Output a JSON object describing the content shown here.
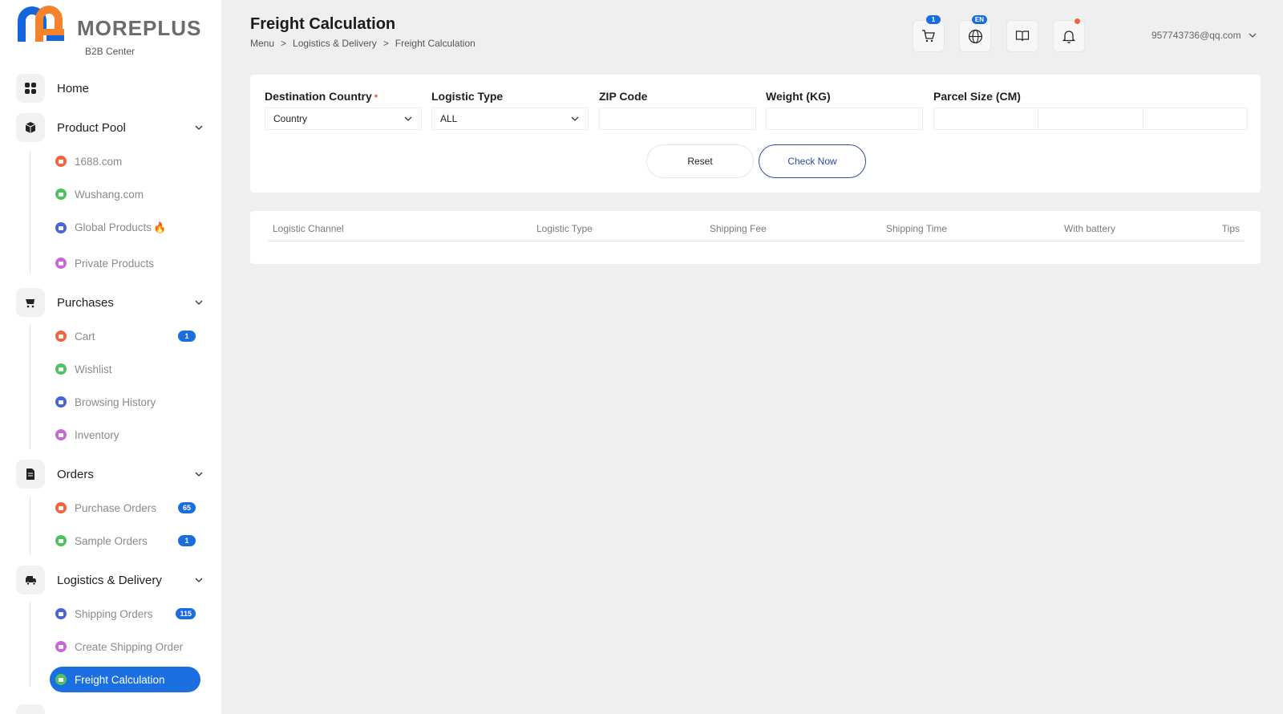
{
  "brand": {
    "name": "MOREPLUS",
    "subtitle": "B2B Center"
  },
  "sidebar": {
    "groups": [
      {
        "label": "Home",
        "icon": "grid-icon"
      },
      {
        "label": "Product Pool",
        "icon": "box-icon",
        "items": [
          {
            "label": "1688.com",
            "color": "#f0653a"
          },
          {
            "label": "Wushang.com",
            "color": "#4cc35e"
          },
          {
            "label": "Global Products",
            "color": "#4a63d6",
            "hot": "🔥"
          },
          {
            "label": "Private Products",
            "color": "#c86ad6"
          }
        ]
      },
      {
        "label": "Purchases",
        "icon": "cart-icon",
        "items": [
          {
            "label": "Cart",
            "color": "#f0653a",
            "badge": "1"
          },
          {
            "label": "Wishlist",
            "color": "#4cc35e"
          },
          {
            "label": "Browsing History",
            "color": "#4a63d6"
          },
          {
            "label": "Inventory",
            "color": "#c86ad6"
          }
        ]
      },
      {
        "label": "Orders",
        "icon": "document-icon",
        "items": [
          {
            "label": "Purchase Orders",
            "color": "#f0653a",
            "badge": "65"
          },
          {
            "label": "Sample Orders",
            "color": "#4cc35e",
            "badge": "1"
          }
        ]
      },
      {
        "label": "Logistics & Delivery",
        "icon": "truck-icon",
        "items": [
          {
            "label": "Shipping Orders",
            "color": "#4a63d6",
            "badge": "115"
          },
          {
            "label": "Create Shipping Order",
            "color": "#c86ad6"
          },
          {
            "label": "Freight Calculation",
            "color": "#4cc35e",
            "active": true
          }
        ]
      }
    ]
  },
  "header": {
    "title": "Freight Calculation",
    "breadcrumb": [
      "Menu",
      ">",
      "Logistics & Delivery",
      ">",
      "Freight Calculation"
    ],
    "cart_badge": "1",
    "lang_badge": "EN",
    "user_email": "957743736@qq.com"
  },
  "form": {
    "destination": {
      "label": "Destination Country",
      "required": "*",
      "value": "Country"
    },
    "logistic_type": {
      "label": "Logistic Type",
      "value": "ALL"
    },
    "zip": {
      "label": "ZIP Code",
      "value": ""
    },
    "weight": {
      "label": "Weight (KG)",
      "value": ""
    },
    "parcel": {
      "label": "Parcel Size (CM)"
    },
    "reset_label": "Reset",
    "check_label": "Check Now"
  },
  "table": {
    "columns": [
      "Logistic Channel",
      "Logistic Type",
      "Shipping Fee",
      "Shipping Time",
      "With battery",
      "Tips"
    ]
  },
  "colors": {
    "accent": "#1b6fe0",
    "check_border": "#2f4ea1"
  }
}
